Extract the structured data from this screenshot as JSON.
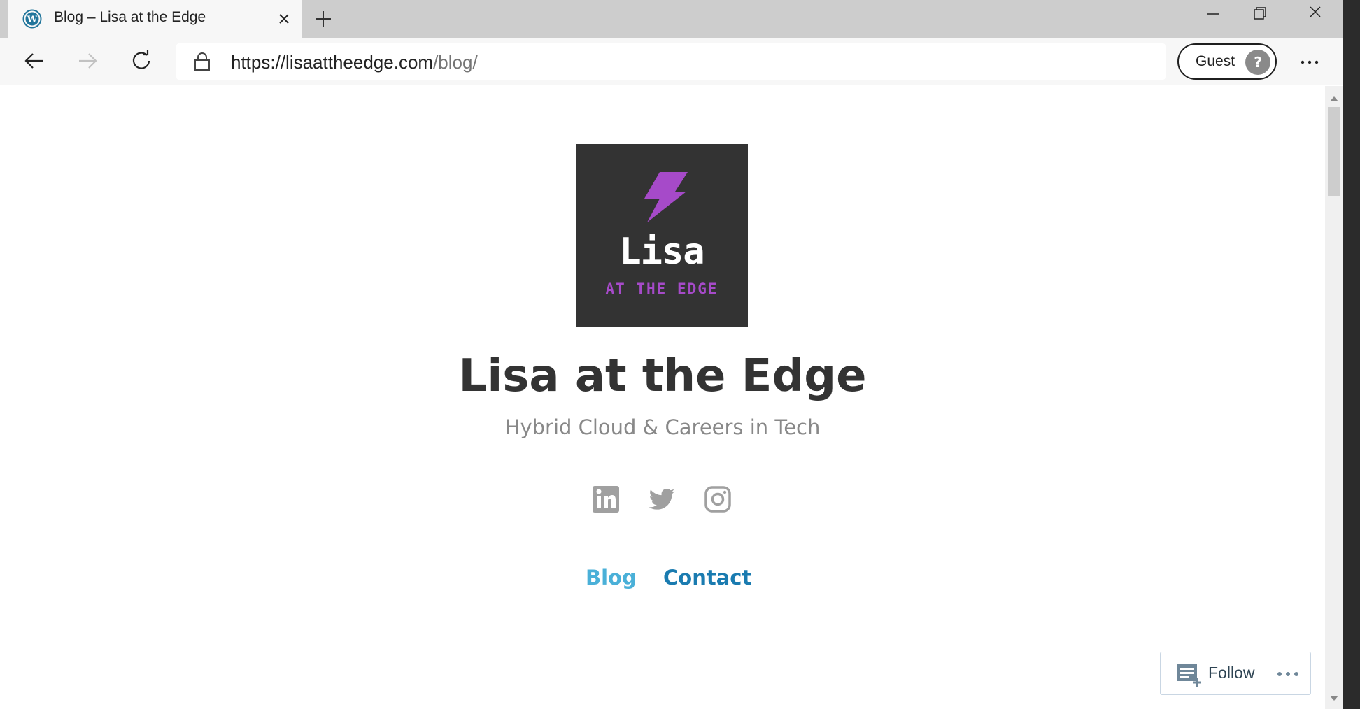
{
  "browser": {
    "tab": {
      "title": "Blog – Lisa at the Edge",
      "favicon": "wordpress-icon"
    },
    "address_bar": {
      "url_host": "https://lisaattheedge.com",
      "url_path": "/blog/"
    },
    "profile": {
      "label": "Guest"
    },
    "icons": [
      "back-arrow-icon",
      "forward-arrow-icon",
      "refresh-icon",
      "lock-icon",
      "more-icon",
      "minimize-icon",
      "restore-icon",
      "close-icon"
    ]
  },
  "site": {
    "logo": {
      "word": "Lisa",
      "tagline": "AT THE EDGE",
      "bg_color": "#333333",
      "accent_color": "#a64ac9"
    },
    "title": "Lisa at the Edge",
    "tagline": "Hybrid Cloud & Careers in Tech",
    "social": [
      "linkedin-icon",
      "twitter-icon",
      "instagram-icon"
    ],
    "menu": [
      {
        "label": "Blog",
        "color": "#4ab0d8"
      },
      {
        "label": "Contact",
        "color": "#1a7bb0"
      }
    ]
  },
  "follow_widget": {
    "label": "Follow"
  }
}
